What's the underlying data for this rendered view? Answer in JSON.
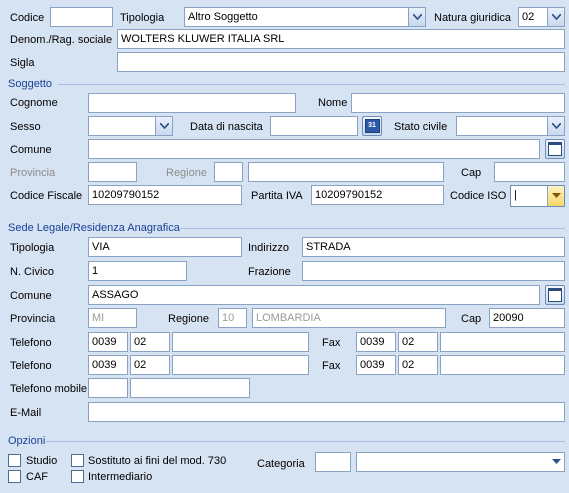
{
  "header": {
    "codice_label": "Codice",
    "codice_value": "",
    "tipologia_label": "Tipologia",
    "tipologia_value": "Altro Soggetto",
    "natura_label": "Natura giuridica",
    "natura_value": "02",
    "denom_label": "Denom./Rag. sociale",
    "denom_value": "WOLTERS KLUWER ITALIA SRL",
    "sigla_label": "Sigla",
    "sigla_value": ""
  },
  "soggetto": {
    "title": "Soggetto",
    "cognome_label": "Cognome",
    "cognome_value": "",
    "nome_label": "Nome",
    "nome_value": "",
    "sesso_label": "Sesso",
    "sesso_value": "",
    "data_nascita_label": "Data di nascita",
    "data_nascita_value": "",
    "calendar_glyph": "31",
    "stato_civile_label": "Stato civile",
    "stato_civile_value": "",
    "comune_label": "Comune",
    "comune_value": "",
    "provincia_label": "Provincia",
    "provincia_value": "",
    "regione_label": "Regione",
    "regione_code": "",
    "regione_name": "",
    "cap_label": "Cap",
    "cap_value": "",
    "codice_fiscale_label": "Codice Fiscale",
    "codice_fiscale_value": "10209790152",
    "partita_iva_label": "Partita IVA",
    "partita_iva_value": "10209790152",
    "codice_iso_label": "Codice ISO",
    "codice_iso_value": "|"
  },
  "sede": {
    "title": "Sede Legale/Residenza Anagrafica",
    "tipologia_label": "Tipologia",
    "tipologia_value": "VIA",
    "indirizzo_label": "Indirizzo",
    "indirizzo_value": "STRADA",
    "civico_label": "N. Civico",
    "civico_value": "1",
    "frazione_label": "Frazione",
    "frazione_value": "",
    "comune_label": "Comune",
    "comune_value": "ASSAGO",
    "provincia_label": "Provincia",
    "provincia_value": "MI",
    "regione_label": "Regione",
    "regione_code": "10",
    "regione_name": "LOMBARDIA",
    "cap_label": "Cap",
    "cap_value": "20090",
    "telefono_label": "Telefono",
    "telefono1_prefix": "0039",
    "telefono1_area": "02",
    "telefono1_number": "",
    "fax_label": "Fax",
    "fax1_prefix": "0039",
    "fax1_area": "02",
    "fax1_number": "",
    "telefono2_prefix": "0039",
    "telefono2_area": "02",
    "telefono2_number": "",
    "fax2_prefix": "0039",
    "fax2_area": "02",
    "fax2_number": "",
    "mobile_label": "Telefono mobile",
    "mobile_prefix": "",
    "mobile_number": "",
    "email_label": "E-Mail",
    "email_value": ""
  },
  "opzioni": {
    "title": "Opzioni",
    "studio_label": "Studio",
    "caf_label": "CAF",
    "sostituto_label": "Sostituto ai fini del mod. 730",
    "intermediario_label": "Intermediario",
    "categoria_label": "Categoria",
    "categoria_code": "",
    "categoria_value": ""
  },
  "colors": {
    "background": "#d6e3f3",
    "section_title": "#1b3f98",
    "disabled_text": "#8c8c8c"
  }
}
